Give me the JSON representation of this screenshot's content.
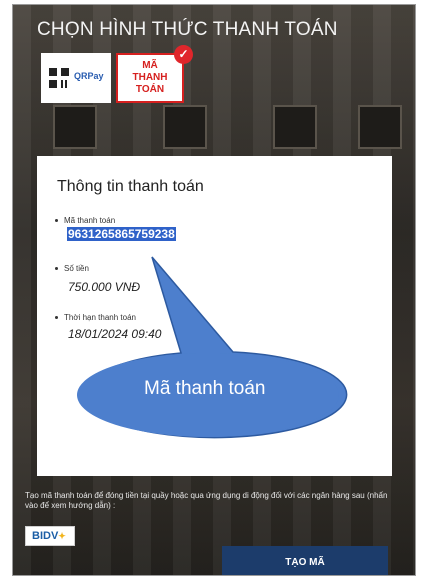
{
  "header": {
    "title": "CHỌN HÌNH THỨC THANH TOÁN"
  },
  "payment_options": {
    "qrpay_label": "QRPay",
    "code_label_line1": "MÃ",
    "code_label_line2": "THANH TOÁN",
    "selected_icon": "check-icon"
  },
  "modal": {
    "title": "Thông tin thanh toán",
    "payment_code_label": "Mã thanh toán",
    "payment_code_value": "9631265865759238",
    "amount_label": "Số tiền",
    "amount_value": "750.000 VNĐ",
    "deadline_label": "Thời hạn thanh toán",
    "deadline_value": "18/01/2024 09:40"
  },
  "callout": {
    "text": "Mã thanh toán",
    "color": "#4d7fcd"
  },
  "footer": {
    "instruction": "Tạo mã thanh toán để đóng tiền tại quầy hoặc qua ứng dụng di động đối với các ngân hàng sau (nhấn vào để xem hướng dẫn) :",
    "bank_label": "BIDV",
    "create_button": "TẠO MÃ"
  },
  "colors": {
    "accent_red": "#d6201f",
    "button_blue": "#1c3c6b",
    "highlight_blue": "#2f62c9"
  }
}
